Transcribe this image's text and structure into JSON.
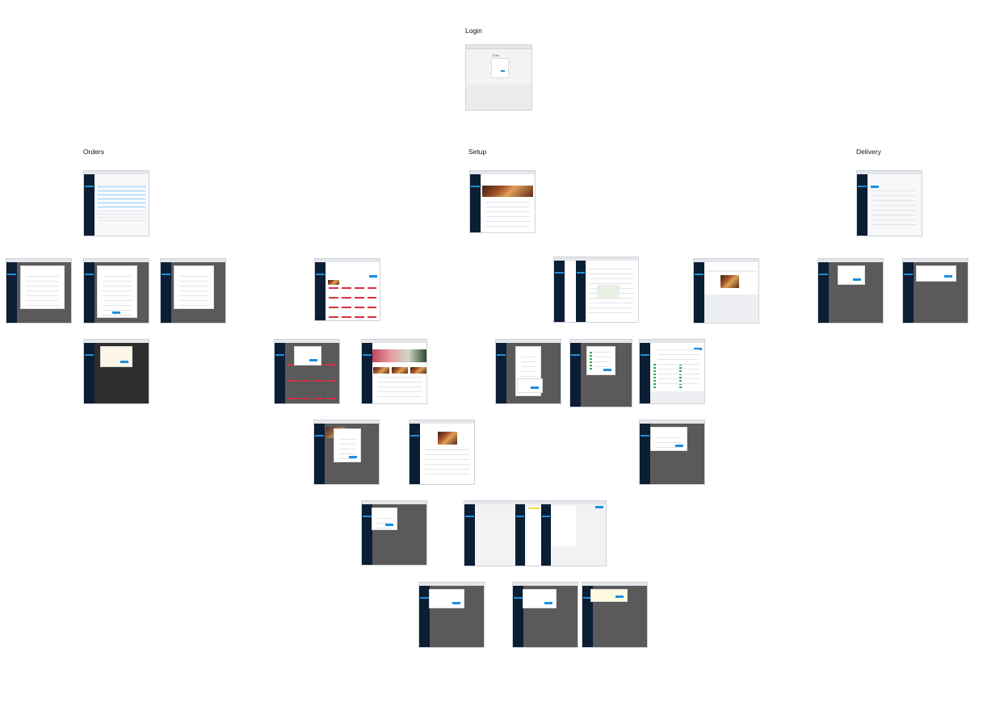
{
  "sections": {
    "login": "Login",
    "orders": "Orders",
    "setup": "Setup",
    "delivery": "Delivery"
  },
  "login_screen": {
    "brand": "Z.itu",
    "sign_in": "Sign In"
  },
  "colors": {
    "sidebar": "#0c1e33",
    "accent": "#1d8fe0",
    "overlay": "#5a5a5a",
    "highlight_red": "#d93040"
  }
}
